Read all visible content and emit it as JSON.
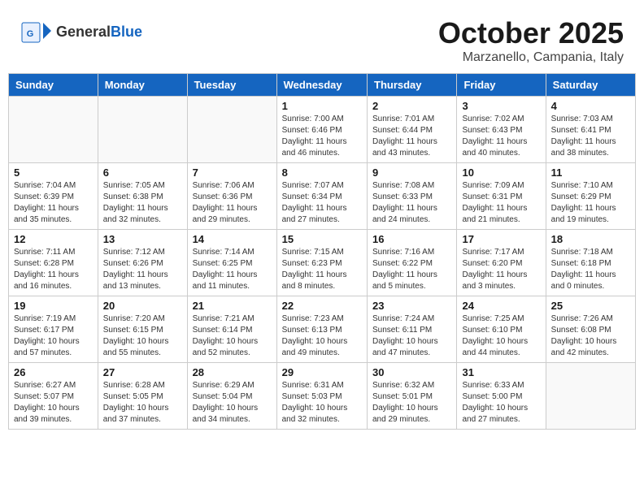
{
  "header": {
    "logo_general": "General",
    "logo_blue": "Blue",
    "month": "October 2025",
    "location": "Marzanello, Campania, Italy"
  },
  "days_of_week": [
    "Sunday",
    "Monday",
    "Tuesday",
    "Wednesday",
    "Thursday",
    "Friday",
    "Saturday"
  ],
  "weeks": [
    [
      {
        "day": "",
        "info": ""
      },
      {
        "day": "",
        "info": ""
      },
      {
        "day": "",
        "info": ""
      },
      {
        "day": "1",
        "info": "Sunrise: 7:00 AM\nSunset: 6:46 PM\nDaylight: 11 hours\nand 46 minutes."
      },
      {
        "day": "2",
        "info": "Sunrise: 7:01 AM\nSunset: 6:44 PM\nDaylight: 11 hours\nand 43 minutes."
      },
      {
        "day": "3",
        "info": "Sunrise: 7:02 AM\nSunset: 6:43 PM\nDaylight: 11 hours\nand 40 minutes."
      },
      {
        "day": "4",
        "info": "Sunrise: 7:03 AM\nSunset: 6:41 PM\nDaylight: 11 hours\nand 38 minutes."
      }
    ],
    [
      {
        "day": "5",
        "info": "Sunrise: 7:04 AM\nSunset: 6:39 PM\nDaylight: 11 hours\nand 35 minutes."
      },
      {
        "day": "6",
        "info": "Sunrise: 7:05 AM\nSunset: 6:38 PM\nDaylight: 11 hours\nand 32 minutes."
      },
      {
        "day": "7",
        "info": "Sunrise: 7:06 AM\nSunset: 6:36 PM\nDaylight: 11 hours\nand 29 minutes."
      },
      {
        "day": "8",
        "info": "Sunrise: 7:07 AM\nSunset: 6:34 PM\nDaylight: 11 hours\nand 27 minutes."
      },
      {
        "day": "9",
        "info": "Sunrise: 7:08 AM\nSunset: 6:33 PM\nDaylight: 11 hours\nand 24 minutes."
      },
      {
        "day": "10",
        "info": "Sunrise: 7:09 AM\nSunset: 6:31 PM\nDaylight: 11 hours\nand 21 minutes."
      },
      {
        "day": "11",
        "info": "Sunrise: 7:10 AM\nSunset: 6:29 PM\nDaylight: 11 hours\nand 19 minutes."
      }
    ],
    [
      {
        "day": "12",
        "info": "Sunrise: 7:11 AM\nSunset: 6:28 PM\nDaylight: 11 hours\nand 16 minutes."
      },
      {
        "day": "13",
        "info": "Sunrise: 7:12 AM\nSunset: 6:26 PM\nDaylight: 11 hours\nand 13 minutes."
      },
      {
        "day": "14",
        "info": "Sunrise: 7:14 AM\nSunset: 6:25 PM\nDaylight: 11 hours\nand 11 minutes."
      },
      {
        "day": "15",
        "info": "Sunrise: 7:15 AM\nSunset: 6:23 PM\nDaylight: 11 hours\nand 8 minutes."
      },
      {
        "day": "16",
        "info": "Sunrise: 7:16 AM\nSunset: 6:22 PM\nDaylight: 11 hours\nand 5 minutes."
      },
      {
        "day": "17",
        "info": "Sunrise: 7:17 AM\nSunset: 6:20 PM\nDaylight: 11 hours\nand 3 minutes."
      },
      {
        "day": "18",
        "info": "Sunrise: 7:18 AM\nSunset: 6:18 PM\nDaylight: 11 hours\nand 0 minutes."
      }
    ],
    [
      {
        "day": "19",
        "info": "Sunrise: 7:19 AM\nSunset: 6:17 PM\nDaylight: 10 hours\nand 57 minutes."
      },
      {
        "day": "20",
        "info": "Sunrise: 7:20 AM\nSunset: 6:15 PM\nDaylight: 10 hours\nand 55 minutes."
      },
      {
        "day": "21",
        "info": "Sunrise: 7:21 AM\nSunset: 6:14 PM\nDaylight: 10 hours\nand 52 minutes."
      },
      {
        "day": "22",
        "info": "Sunrise: 7:23 AM\nSunset: 6:13 PM\nDaylight: 10 hours\nand 49 minutes."
      },
      {
        "day": "23",
        "info": "Sunrise: 7:24 AM\nSunset: 6:11 PM\nDaylight: 10 hours\nand 47 minutes."
      },
      {
        "day": "24",
        "info": "Sunrise: 7:25 AM\nSunset: 6:10 PM\nDaylight: 10 hours\nand 44 minutes."
      },
      {
        "day": "25",
        "info": "Sunrise: 7:26 AM\nSunset: 6:08 PM\nDaylight: 10 hours\nand 42 minutes."
      }
    ],
    [
      {
        "day": "26",
        "info": "Sunrise: 6:27 AM\nSunset: 5:07 PM\nDaylight: 10 hours\nand 39 minutes."
      },
      {
        "day": "27",
        "info": "Sunrise: 6:28 AM\nSunset: 5:05 PM\nDaylight: 10 hours\nand 37 minutes."
      },
      {
        "day": "28",
        "info": "Sunrise: 6:29 AM\nSunset: 5:04 PM\nDaylight: 10 hours\nand 34 minutes."
      },
      {
        "day": "29",
        "info": "Sunrise: 6:31 AM\nSunset: 5:03 PM\nDaylight: 10 hours\nand 32 minutes."
      },
      {
        "day": "30",
        "info": "Sunrise: 6:32 AM\nSunset: 5:01 PM\nDaylight: 10 hours\nand 29 minutes."
      },
      {
        "day": "31",
        "info": "Sunrise: 6:33 AM\nSunset: 5:00 PM\nDaylight: 10 hours\nand 27 minutes."
      },
      {
        "day": "",
        "info": ""
      }
    ]
  ]
}
